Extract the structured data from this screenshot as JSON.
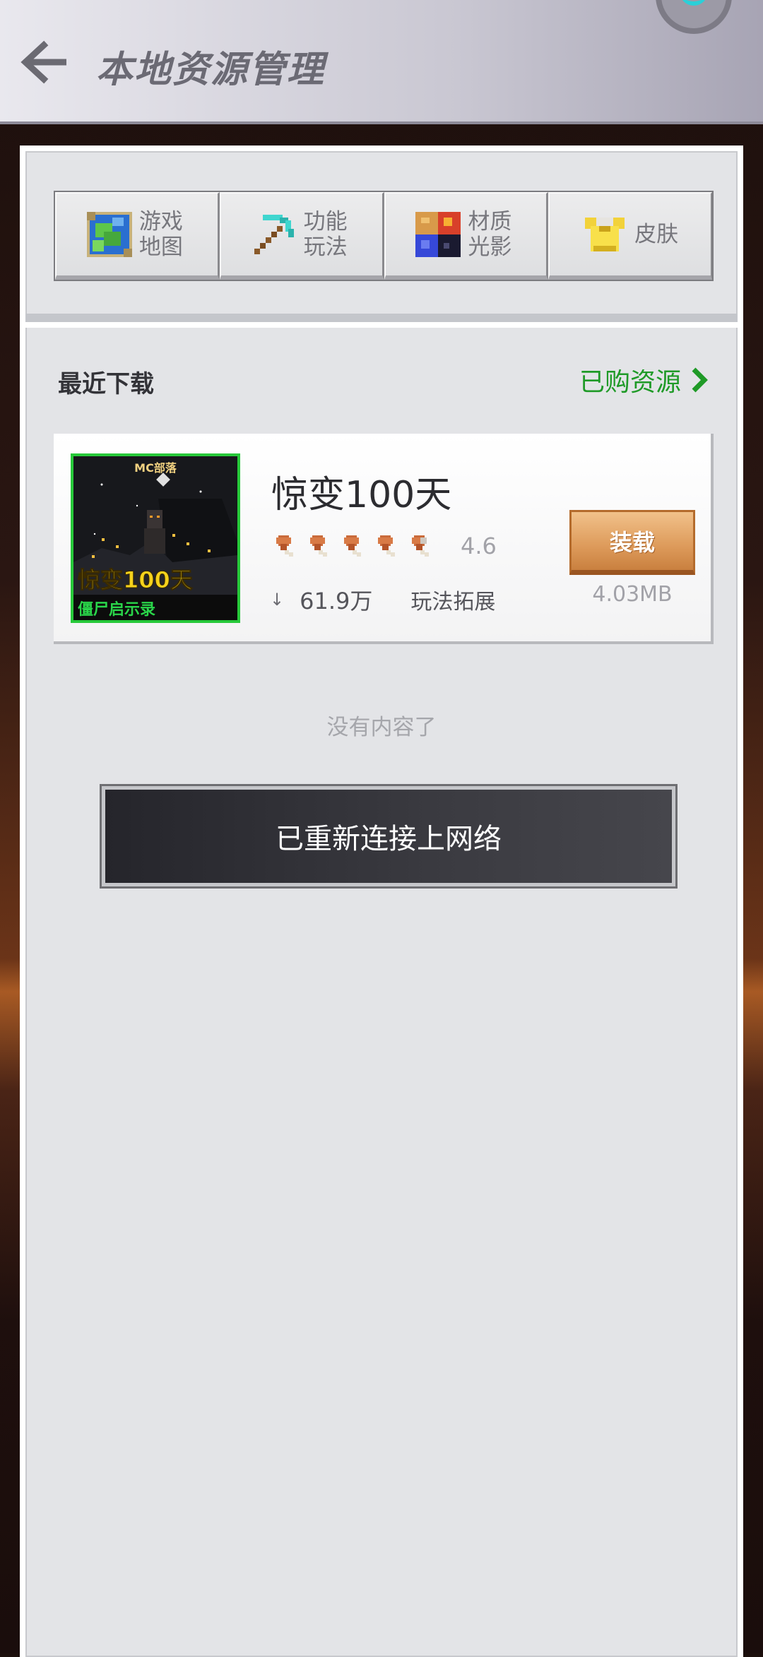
{
  "header": {
    "title": "本地资源管理"
  },
  "tabs": [
    {
      "label_line1": "游戏",
      "label_line2": "地图",
      "icon": "map-icon"
    },
    {
      "label_line1": "功能",
      "label_line2": "玩法",
      "icon": "pickaxe-icon"
    },
    {
      "label_line1": "材质",
      "label_line2": "光影",
      "icon": "texture-icon"
    },
    {
      "label_line1": "皮肤",
      "label_line2": "",
      "icon": "armor-icon"
    }
  ],
  "section": {
    "title": "最近下载",
    "purchased_link": "已购资源"
  },
  "resource": {
    "name": "惊变100天",
    "thumb_brand": "MC部落",
    "thumb_title": "惊变100天",
    "thumb_subtitle": "僵尸启示录",
    "rating": 4.6,
    "rating_text": "4.6",
    "downloads": "61.9万",
    "category": "玩法拓展",
    "button_label": "装载",
    "size": "4.03MB"
  },
  "empty_note": "没有内容了",
  "toast": "已重新连接上网络",
  "colors": {
    "accent_green": "#1f9a27",
    "load_button": "#dd9a5a",
    "toast_bg": "#2f2f35"
  }
}
